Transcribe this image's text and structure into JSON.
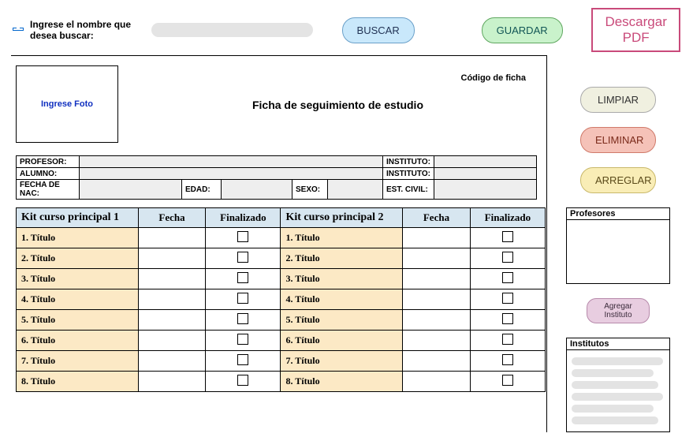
{
  "top": {
    "search_label": "Ingrese el nombre que desea buscar:",
    "buscar": "BUSCAR",
    "guardar": "GUARDAR",
    "descargar_pdf": "Descargar PDF"
  },
  "side": {
    "limpiar": "LIMPIAR",
    "eliminar": "ELIMINAR",
    "arreglar": "ARREGLAR",
    "profesores_title": "Profesores",
    "agregar_instituto": "Agregar Instituto",
    "institutos_title": "Institutos"
  },
  "sheet": {
    "photo_placeholder": "Ingrese Foto",
    "codigo_label": "Código de ficha",
    "title": "Ficha de seguimiento de estudio"
  },
  "info": {
    "profesor_label": "PROFESOR:",
    "alumno_label": "ALUMNO:",
    "fecha_nac_label": "FECHA DE NAC:",
    "edad_label": "EDAD:",
    "sexo_label": "SEXO:",
    "instituto1_label": "INSTITUTO:",
    "instituto2_label": "INSTITUTO:",
    "estcivil_label": "EST. CIVIL:"
  },
  "kit": {
    "headers": {
      "kit1": "Kit curso principal 1",
      "kit2": "Kit curso principal 2",
      "fecha": "Fecha",
      "finalizado": "Finalizado"
    },
    "rows1": [
      "1. Título",
      "2. Título",
      "3. Título",
      "4. Título",
      "5. Título",
      "6. Título",
      "7. Título",
      "8. Título"
    ],
    "rows2": [
      "1. Título",
      "2. Título",
      "3. Título",
      "4. Título",
      "5. Título",
      "6. Título",
      "7. Título",
      "8. Título"
    ]
  }
}
